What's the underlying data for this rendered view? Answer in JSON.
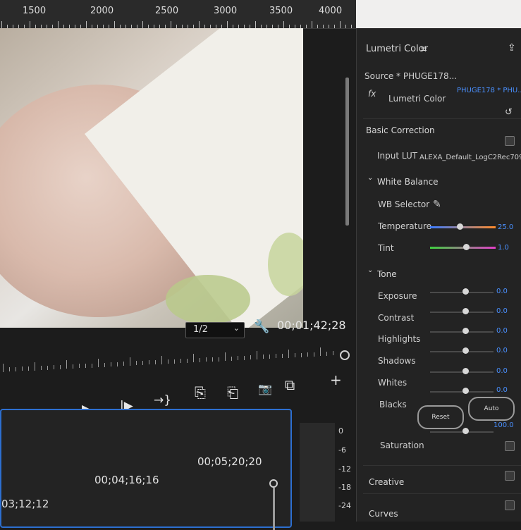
{
  "ruler": {
    "labels": [
      "1500",
      "2000",
      "2500",
      "3000",
      "3500",
      "4000"
    ]
  },
  "program": {
    "zoom_value": "1/2",
    "timecode": "00;01;42;28",
    "icons": {
      "wrench": "wrench-icon",
      "settings": "settings-icon",
      "add": "plus-icon"
    }
  },
  "transport": {
    "mark_in": "⇤",
    "step_back": "◀|",
    "play": "▶",
    "step_forward": "|▶",
    "go_to_out": "→}",
    "insert": "⎘",
    "overwrite": "⎗",
    "camera": "📷",
    "compare": "⧉",
    "add": "+"
  },
  "timeline": {
    "timecodes": [
      "03;12;12",
      "00;04;16;16",
      "00;05;20;20"
    ]
  },
  "audio_meter": {
    "labels": [
      "0",
      "-6",
      "-12",
      "-18",
      "-24"
    ]
  },
  "lumetri": {
    "title": "Lumetri Color",
    "source_label": "Source * PHUGE178...",
    "source_clip": "PHUGE178 * PHU...",
    "fx_label": "Lumetri Color",
    "basic_correction": "Basic Correction",
    "input_lut_label": "Input LUT",
    "input_lut_value": "ALEXA_Default_LogC2Rec709",
    "white_balance": "White Balance",
    "wb_selector": "WB Selector",
    "temperature": {
      "label": "Temperature",
      "value": "25.0",
      "level": 0.45
    },
    "tint": {
      "label": "Tint",
      "value": "1.0",
      "level": 0.55
    },
    "tone": "Tone",
    "exposure": {
      "label": "Exposure",
      "value": "0.0",
      "level": 0.55
    },
    "contrast": {
      "label": "Contrast",
      "value": "0.0",
      "level": 0.55
    },
    "highlights": {
      "label": "Highlights",
      "value": "0.0",
      "level": 0.55
    },
    "shadows": {
      "label": "Shadows",
      "value": "0.0",
      "level": 0.55
    },
    "whites": {
      "label": "Whites",
      "value": "0.0",
      "level": 0.55
    },
    "blacks": {
      "label": "Blacks",
      "value": "0.0",
      "level": 0.55
    },
    "reset_label": "Reset",
    "auto_label": "Auto",
    "saturation": {
      "label": "Saturation",
      "value": "100.0",
      "level": 0.55
    },
    "creative": "Creative",
    "curves": "Curves",
    "colors": {
      "accent": "#4a90ff",
      "temperature_left": "#3a7bff",
      "temperature_right": "#ff8a2a",
      "tint_left": "#3ecf3e",
      "tint_right": "#e23ec9"
    }
  }
}
